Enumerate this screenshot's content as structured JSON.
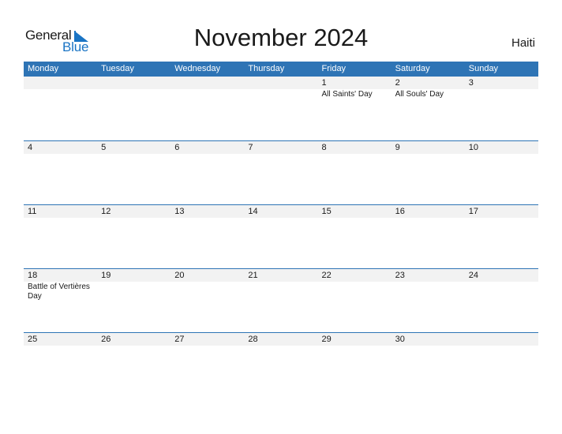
{
  "logo": {
    "general": "General",
    "blue": "Blue"
  },
  "title": "November 2024",
  "country": "Haiti",
  "weekdays": [
    "Monday",
    "Tuesday",
    "Wednesday",
    "Thursday",
    "Friday",
    "Saturday",
    "Sunday"
  ],
  "weeks": [
    {
      "days": [
        {
          "num": "",
          "holiday": ""
        },
        {
          "num": "",
          "holiday": ""
        },
        {
          "num": "",
          "holiday": ""
        },
        {
          "num": "",
          "holiday": ""
        },
        {
          "num": "1",
          "holiday": "All Saints' Day"
        },
        {
          "num": "2",
          "holiday": "All Souls' Day"
        },
        {
          "num": "3",
          "holiday": ""
        }
      ]
    },
    {
      "days": [
        {
          "num": "4",
          "holiday": ""
        },
        {
          "num": "5",
          "holiday": ""
        },
        {
          "num": "6",
          "holiday": ""
        },
        {
          "num": "7",
          "holiday": ""
        },
        {
          "num": "8",
          "holiday": ""
        },
        {
          "num": "9",
          "holiday": ""
        },
        {
          "num": "10",
          "holiday": ""
        }
      ]
    },
    {
      "days": [
        {
          "num": "11",
          "holiday": ""
        },
        {
          "num": "12",
          "holiday": ""
        },
        {
          "num": "13",
          "holiday": ""
        },
        {
          "num": "14",
          "holiday": ""
        },
        {
          "num": "15",
          "holiday": ""
        },
        {
          "num": "16",
          "holiday": ""
        },
        {
          "num": "17",
          "holiday": ""
        }
      ]
    },
    {
      "days": [
        {
          "num": "18",
          "holiday": "Battle of Vertières Day"
        },
        {
          "num": "19",
          "holiday": ""
        },
        {
          "num": "20",
          "holiday": ""
        },
        {
          "num": "21",
          "holiday": ""
        },
        {
          "num": "22",
          "holiday": ""
        },
        {
          "num": "23",
          "holiday": ""
        },
        {
          "num": "24",
          "holiday": ""
        }
      ]
    },
    {
      "days": [
        {
          "num": "25",
          "holiday": ""
        },
        {
          "num": "26",
          "holiday": ""
        },
        {
          "num": "27",
          "holiday": ""
        },
        {
          "num": "28",
          "holiday": ""
        },
        {
          "num": "29",
          "holiday": ""
        },
        {
          "num": "30",
          "holiday": ""
        },
        {
          "num": "",
          "holiday": ""
        }
      ]
    }
  ],
  "colors": {
    "accent": "#2e74b5",
    "band": "#f2f2f2",
    "logo_blue": "#1a74c4"
  }
}
